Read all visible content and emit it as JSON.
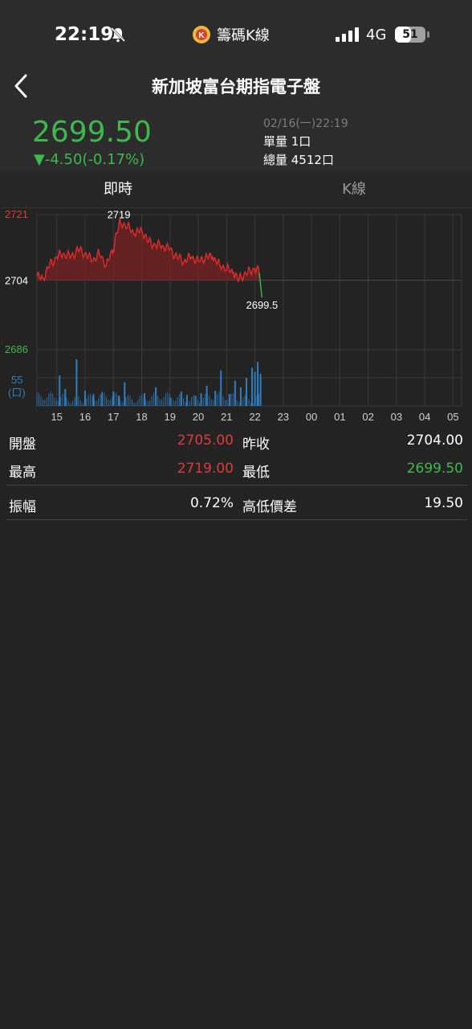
{
  "status_bar": {
    "time": "22:19",
    "app_name": "籌碼K線",
    "network": "4G",
    "battery": "51",
    "icons": [
      "bell-muted-icon",
      "app-logo-icon",
      "signal-icon",
      "battery-icon"
    ]
  },
  "header": {
    "title": "新加坡富台期指電子盤",
    "back_icon": "chevron-left-icon"
  },
  "quote": {
    "price": "2699.50",
    "change": "▼-4.50(-0.17%)",
    "datetime": "02/16(一)22:19",
    "single_volume": "單量 1口",
    "total_volume": "總量 4512口"
  },
  "tabs": [
    {
      "label": "即時",
      "active": true
    },
    {
      "label": "K線",
      "active": false
    }
  ],
  "chart_data": {
    "type": "line",
    "y_ticks": {
      "max": "2721",
      "mid": "2704",
      "min": "2686"
    },
    "volume_ticks": {
      "value": "55",
      "unit": "(口)"
    },
    "annotations": {
      "high": "2719",
      "last": "2699.5"
    },
    "x_ticks": [
      "15",
      "16",
      "17",
      "18",
      "19",
      "20",
      "21",
      "22",
      "23",
      "00",
      "01",
      "02",
      "03",
      "04",
      "05"
    ],
    "ylim": [
      2686,
      2721
    ],
    "reference": 2704,
    "series": [
      {
        "x": [
          14.3,
          14.5,
          14.75,
          15.0,
          15.25,
          15.5,
          15.75,
          16.0,
          16.25,
          16.5,
          16.75,
          17.0,
          17.1,
          17.25,
          17.5,
          17.75,
          18.0,
          18.25,
          18.5,
          18.75,
          19.0,
          19.25,
          19.5,
          19.75,
          20.0,
          20.25,
          20.5,
          20.75,
          21.0,
          21.25,
          21.4,
          21.5,
          21.75,
          22.0,
          22.15,
          22.25
        ],
        "values": [
          2705,
          2704.5,
          2708,
          2710,
          2711,
          2710,
          2712,
          2711,
          2709,
          2711,
          2708,
          2712,
          2716,
          2719,
          2718,
          2716,
          2717,
          2714,
          2713,
          2713,
          2712,
          2710,
          2709,
          2710,
          2709,
          2710,
          2710,
          2708,
          2707,
          2706,
          2704,
          2705,
          2706,
          2707,
          2706,
          2699.5
        ]
      }
    ],
    "volume_max": 55,
    "volume": {
      "x": [
        15.1,
        15.3,
        15.7,
        16.0,
        16.3,
        16.6,
        17.0,
        17.2,
        17.4,
        18.1,
        18.5,
        19.0,
        19.4,
        19.6,
        19.9,
        20.1,
        20.3,
        20.6,
        20.8,
        21.1,
        21.3,
        21.5,
        21.7,
        21.9,
        22.0,
        22.1,
        22.2
      ],
      "values": [
        36,
        20,
        55,
        18,
        14,
        16,
        17,
        12,
        28,
        15,
        22,
        10,
        17,
        13,
        12,
        15,
        24,
        18,
        42,
        14,
        30,
        22,
        33,
        45,
        40,
        52,
        38
      ]
    },
    "colors": {
      "line": "#e02c2c",
      "fill": "#7a2222",
      "tail": "#3fb84e",
      "volume": "#2f7ec0",
      "grid": "#3a3a3a"
    }
  },
  "stats": [
    {
      "left": {
        "label": "開盤",
        "value": "2705.00",
        "color": "#e03a3a"
      },
      "right": {
        "label": "昨收",
        "value": "2704.00",
        "color": "#ffffff"
      }
    },
    {
      "left": {
        "label": "最高",
        "value": "2719.00",
        "color": "#e03a3a"
      },
      "right": {
        "label": "最低",
        "value": "2699.50",
        "color": "#3fb84e"
      }
    },
    {
      "left": {
        "label": "振幅",
        "value": "0.72%",
        "color": "#ffffff"
      },
      "right": {
        "label": "高低價差",
        "value": "19.50",
        "color": "#ffffff"
      }
    }
  ]
}
